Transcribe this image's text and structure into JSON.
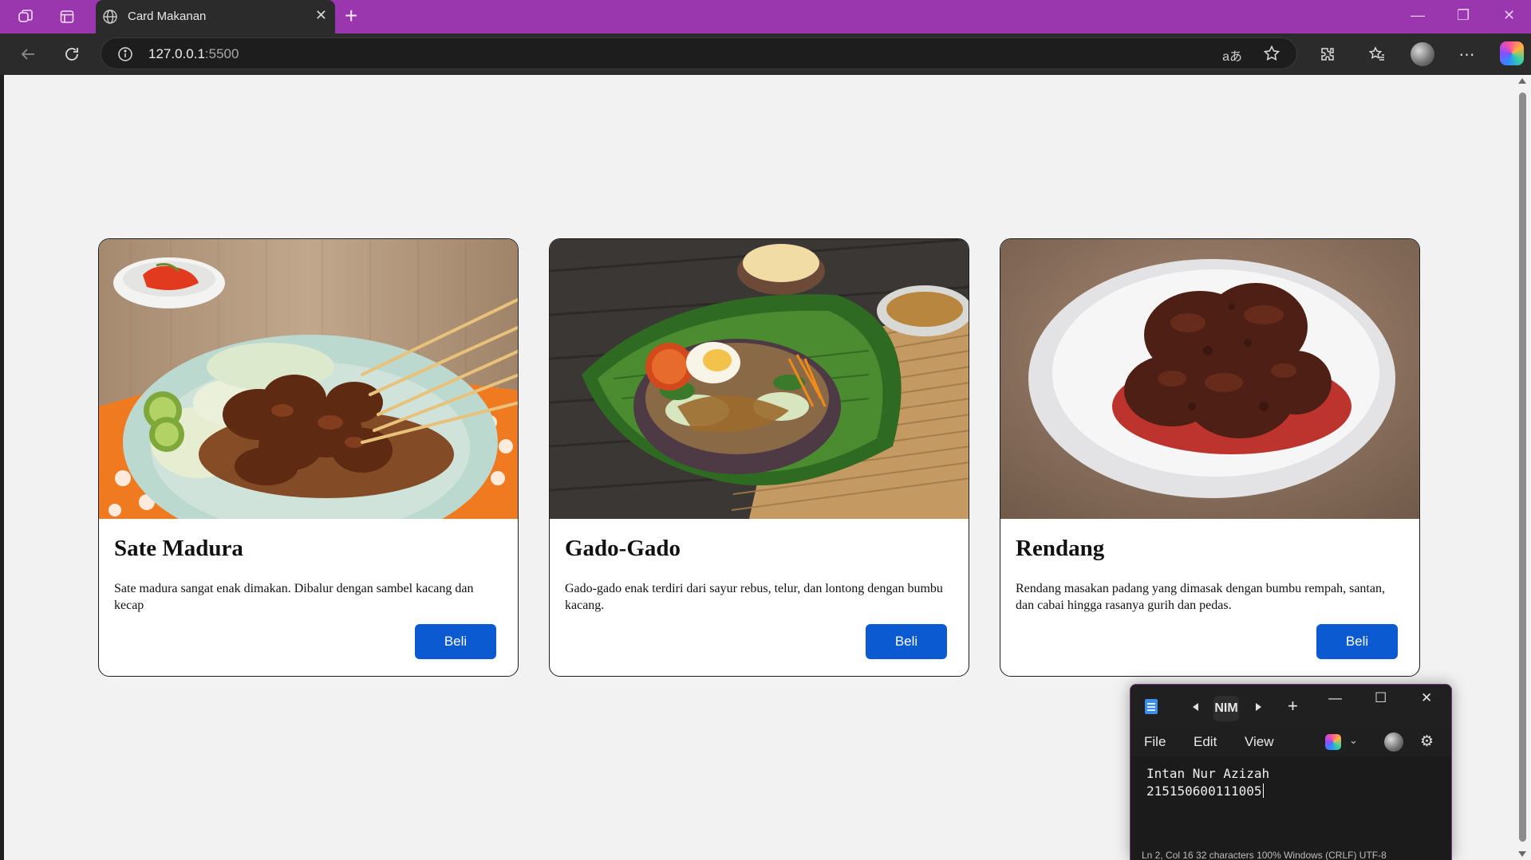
{
  "browser": {
    "tab_title": "Card Makanan",
    "new_tab_icon": "plus-icon",
    "address": {
      "host": "127.0.0.1",
      "port": ":5500"
    },
    "read_aloud_label": "aあ",
    "theme_color": "#9a36ae"
  },
  "page": {
    "cards": [
      {
        "title": "Sate Madura",
        "description": "Sate madura sangat enak dimakan. Dibalur dengan sambel kacang dan kecap",
        "button_label": "Beli"
      },
      {
        "title": "Gado-Gado",
        "description": "Gado-gado enak terdiri dari sayur rebus, telur, dan lontong dengan bumbu kacang.",
        "button_label": "Beli"
      },
      {
        "title": "Rendang",
        "description": "Rendang masakan padang yang dimasak dengan bumbu rempah, santan, dan cabai hingga rasanya gurih dan pedas.",
        "button_label": "Beli"
      }
    ],
    "button_color": "#0b5ad1"
  },
  "notepad": {
    "tab_label": "NIM",
    "menu": {
      "file": "File",
      "edit": "Edit",
      "view": "View"
    },
    "content": {
      "line1": "Intan Nur Azizah",
      "line2": "215150600111005"
    },
    "status": "Ln 2, Col 16    32 characters    100%    Windows (CRLF)    UTF-8"
  }
}
